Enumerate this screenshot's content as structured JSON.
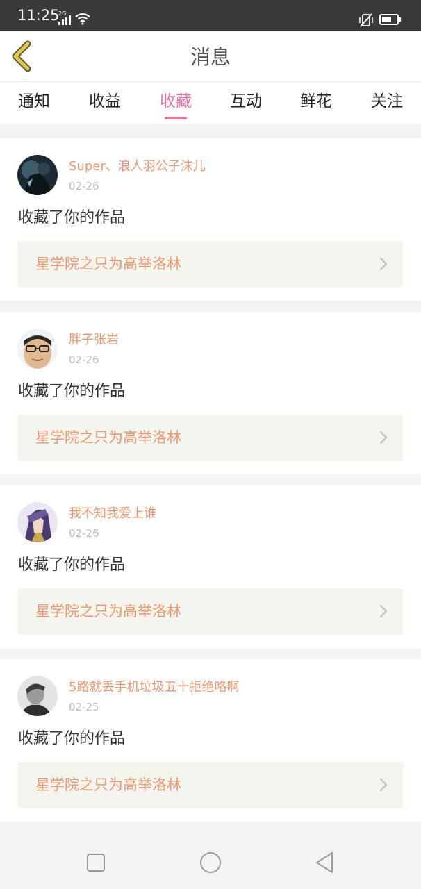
{
  "status_bar": {
    "time": "11:25",
    "network": "2G"
  },
  "header": {
    "title": "消息",
    "back_icon": "chevron-left-icon"
  },
  "tabs": [
    {
      "label": "通知",
      "active": false
    },
    {
      "label": "收益",
      "active": false
    },
    {
      "label": "收藏",
      "active": true
    },
    {
      "label": "互动",
      "active": false
    },
    {
      "label": "鲜花",
      "active": false
    },
    {
      "label": "关注",
      "active": false
    }
  ],
  "messages": [
    {
      "username": "Super、浪人羽公子沫儿",
      "date": "02-26",
      "action": "收藏了你的作品",
      "work_title": "星学院之只为高举洛林"
    },
    {
      "username": "胖子张岩",
      "date": "02-26",
      "action": "收藏了你的作品",
      "work_title": "星学院之只为高举洛林"
    },
    {
      "username": "我不知我爱上谁",
      "date": "02-26",
      "action": "收藏了你的作品",
      "work_title": "星学院之只为高举洛林"
    },
    {
      "username": "5路就丢手机垃圾五十拒绝咯啊",
      "date": "02-25",
      "action": "收藏了你的作品",
      "work_title": "星学院之只为高举洛林"
    }
  ],
  "colors": {
    "accent": "#ee6ea1",
    "username": "#f0956e",
    "back_icon": "#e8c93a",
    "link_bg": "#f5f5ef"
  }
}
